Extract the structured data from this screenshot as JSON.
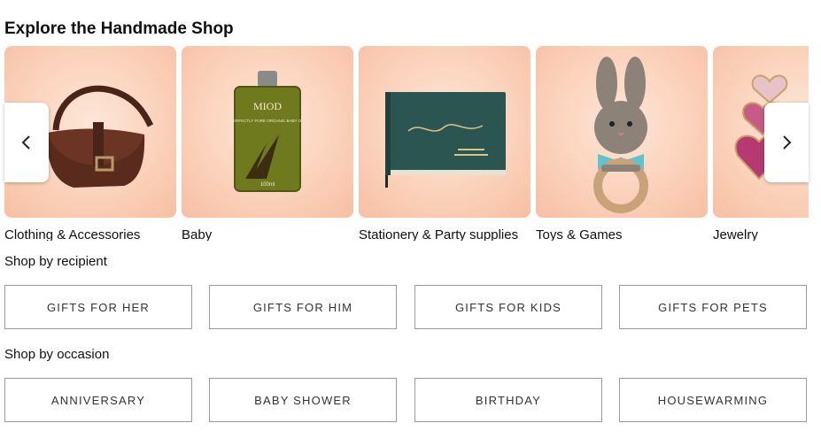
{
  "title": "Explore the Handmade Shop",
  "categories": [
    {
      "label": "Clothing & Accessories",
      "icon": "leather-bag-icon"
    },
    {
      "label": "Baby",
      "icon": "baby-oil-bottle-icon",
      "bottle_brand": "MIOD",
      "bottle_text": "PERFECTLY PURE ORGANIC BABY OIL",
      "bottle_size": "100ml"
    },
    {
      "label": "Stationery & Party supplies",
      "icon": "guest-book-icon"
    },
    {
      "label": "Toys & Games",
      "icon": "bunny-rattle-icon"
    },
    {
      "label": "Jewelry",
      "icon": "heart-earrings-icon"
    }
  ],
  "carousel": {
    "prev_icon": "chevron-left-icon",
    "next_icon": "chevron-right-icon"
  },
  "recipient": {
    "heading": "Shop by recipient",
    "items": [
      "GIFTS FOR HER",
      "GIFTS FOR HIM",
      "GIFTS FOR KIDS",
      "GIFTS FOR PETS"
    ]
  },
  "occasion": {
    "heading": "Shop by occasion",
    "items": [
      "ANNIVERSARY",
      "BABY SHOWER",
      "BIRTHDAY",
      "HOUSEWARMING"
    ]
  },
  "colors": {
    "card_bg": "#fbd2bb",
    "text": "#0f1111",
    "pill_border": "#9a9a9a"
  }
}
